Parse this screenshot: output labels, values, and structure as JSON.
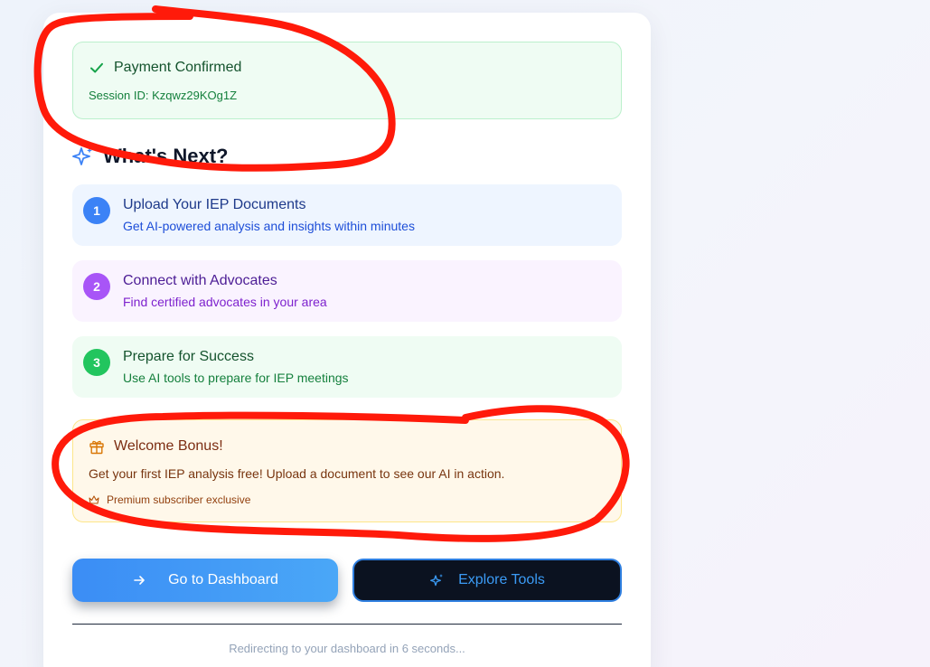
{
  "confirmation": {
    "title": "Payment Confirmed",
    "session_label": "Session ID: Kzqwz29KOg1Z"
  },
  "next": {
    "heading": "What's Next?",
    "steps": [
      {
        "number": "1",
        "title": "Upload Your IEP Documents",
        "description": "Get AI-powered analysis and insights within minutes",
        "color": "#3b82f6"
      },
      {
        "number": "2",
        "title": "Connect with Advocates",
        "description": "Find certified advocates in your area",
        "color": "#a855f7"
      },
      {
        "number": "3",
        "title": "Prepare for Success",
        "description": "Use AI tools to prepare for IEP meetings",
        "color": "#22c55e"
      }
    ]
  },
  "bonus": {
    "title": "Welcome Bonus!",
    "description": "Get your first IEP analysis free! Upload a document to see our AI in action.",
    "exclusive": "Premium subscriber exclusive"
  },
  "buttons": {
    "dashboard": "Go to Dashboard",
    "explore": "Explore Tools"
  },
  "footer": {
    "redirect": "Redirecting to your dashboard in 6 seconds..."
  },
  "icons": [
    "check-icon",
    "sparkles-icon",
    "gift-icon",
    "crown-icon",
    "arrow-right-icon",
    "sparkles-icon"
  ],
  "annotation_color": "#ff1a0a"
}
